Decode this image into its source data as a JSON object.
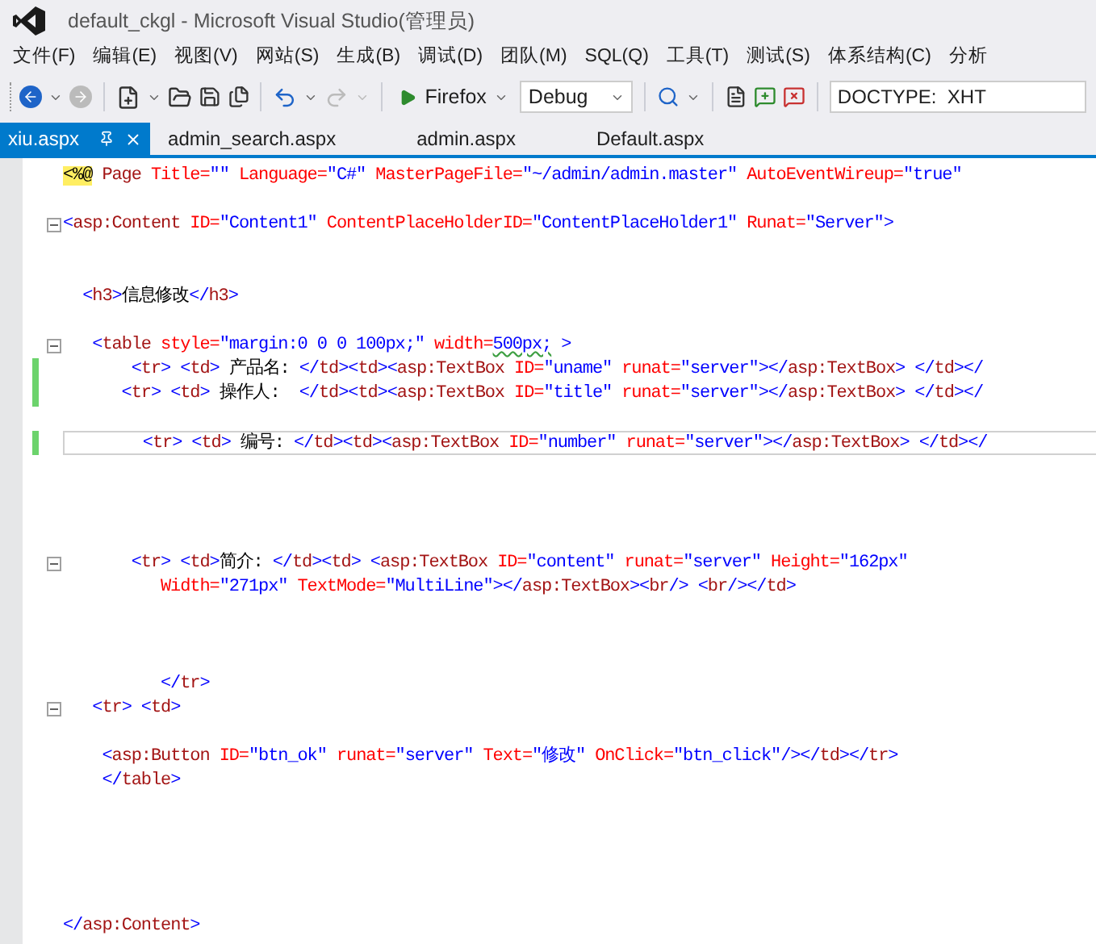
{
  "window": {
    "title": "default_ckgl - Microsoft Visual Studio(管理员)"
  },
  "menu": [
    "文件(F)",
    "编辑(E)",
    "视图(V)",
    "网站(S)",
    "生成(B)",
    "调试(D)",
    "团队(M)",
    "SQL(Q)",
    "工具(T)",
    "测试(S)",
    "体系结构(C)",
    "分析"
  ],
  "toolbar": {
    "browser": "Firefox",
    "configuration": "Debug",
    "doctype": "DOCTYPE:  XHT"
  },
  "tabs": [
    {
      "label": "xiu.aspx",
      "selected": true
    },
    {
      "label": "admin_search.aspx",
      "selected": false
    },
    {
      "label": "admin.aspx",
      "selected": false
    },
    {
      "label": "Default.aspx",
      "selected": false
    }
  ],
  "editor": {
    "lines": [
      {
        "kind": "code",
        "fold": false,
        "changed": false,
        "current": false,
        "tokens": [
          {
            "kind": "directive",
            "text": "<%@"
          },
          {
            "kind": "tag",
            "text": " Page "
          },
          {
            "kind": "attr",
            "text": "Title="
          },
          {
            "kind": "value",
            "text": "\"\""
          },
          {
            "kind": "attr",
            "text": " Language="
          },
          {
            "kind": "value",
            "text": "\"C#\""
          },
          {
            "kind": "attr",
            "text": " MasterPageFile="
          },
          {
            "kind": "value",
            "text": "\"~/admin/admin.master\""
          },
          {
            "kind": "attr",
            "text": " AutoEventWireup="
          },
          {
            "kind": "value",
            "text": "\"true\""
          }
        ]
      },
      {
        "kind": "blank"
      },
      {
        "kind": "code",
        "fold": true,
        "changed": false,
        "current": false,
        "tokens": [
          {
            "kind": "punct",
            "text": "<"
          },
          {
            "kind": "tag",
            "text": "asp:Content"
          },
          {
            "kind": "attr",
            "text": " ID="
          },
          {
            "kind": "value",
            "text": "\"Content1\""
          },
          {
            "kind": "attr",
            "text": " ContentPlaceHolderID="
          },
          {
            "kind": "value",
            "text": "\"ContentPlaceHolder1\""
          },
          {
            "kind": "attr",
            "text": " Runat="
          },
          {
            "kind": "value",
            "text": "\"Server\""
          },
          {
            "kind": "punct",
            "text": ">"
          }
        ]
      },
      {
        "kind": "blank"
      },
      {
        "kind": "blank"
      },
      {
        "kind": "code",
        "fold": false,
        "changed": false,
        "current": false,
        "tokens": [
          {
            "kind": "punct",
            "text": "  <"
          },
          {
            "kind": "tag",
            "text": "h3"
          },
          {
            "kind": "punct",
            "text": ">"
          },
          {
            "kind": "text",
            "text": "信息修改"
          },
          {
            "kind": "punct",
            "text": "</"
          },
          {
            "kind": "tag",
            "text": "h3"
          },
          {
            "kind": "punct",
            "text": ">"
          }
        ]
      },
      {
        "kind": "blank"
      },
      {
        "kind": "code",
        "fold": true,
        "changed": false,
        "current": false,
        "tokens": [
          {
            "kind": "punct",
            "text": "   <"
          },
          {
            "kind": "tag",
            "text": "table"
          },
          {
            "kind": "attr",
            "text": " style="
          },
          {
            "kind": "value",
            "text": "\"margin:0 0 0 100px;\""
          },
          {
            "kind": "attr",
            "text": " width="
          },
          {
            "kind": "squiggle",
            "text": "500px;"
          },
          {
            "kind": "punct",
            "text": " >"
          }
        ]
      },
      {
        "kind": "code",
        "fold": false,
        "changed": true,
        "current": false,
        "tokens": [
          {
            "kind": "punct",
            "text": "       <"
          },
          {
            "kind": "tag",
            "text": "tr"
          },
          {
            "kind": "punct",
            "text": "> <"
          },
          {
            "kind": "tag",
            "text": "td"
          },
          {
            "kind": "punct",
            "text": "> "
          },
          {
            "kind": "text",
            "text": "产品名: "
          },
          {
            "kind": "punct",
            "text": "</"
          },
          {
            "kind": "tag",
            "text": "td"
          },
          {
            "kind": "punct",
            "text": "><"
          },
          {
            "kind": "tag",
            "text": "td"
          },
          {
            "kind": "punct",
            "text": "><"
          },
          {
            "kind": "tag",
            "text": "asp:TextBox"
          },
          {
            "kind": "attr",
            "text": " ID="
          },
          {
            "kind": "value",
            "text": "\"uname\""
          },
          {
            "kind": "attr",
            "text": " runat="
          },
          {
            "kind": "value",
            "text": "\"server\""
          },
          {
            "kind": "punct",
            "text": "></"
          },
          {
            "kind": "tag",
            "text": "asp:TextBox"
          },
          {
            "kind": "punct",
            "text": "> </"
          },
          {
            "kind": "tag",
            "text": "td"
          },
          {
            "kind": "punct",
            "text": "></"
          }
        ]
      },
      {
        "kind": "code",
        "fold": false,
        "changed": true,
        "current": false,
        "tokens": [
          {
            "kind": "punct",
            "text": "      <"
          },
          {
            "kind": "tag",
            "text": "tr"
          },
          {
            "kind": "punct",
            "text": "> <"
          },
          {
            "kind": "tag",
            "text": "td"
          },
          {
            "kind": "punct",
            "text": "> "
          },
          {
            "kind": "text",
            "text": "操作人:  "
          },
          {
            "kind": "punct",
            "text": "</"
          },
          {
            "kind": "tag",
            "text": "td"
          },
          {
            "kind": "punct",
            "text": "><"
          },
          {
            "kind": "tag",
            "text": "td"
          },
          {
            "kind": "punct",
            "text": "><"
          },
          {
            "kind": "tag",
            "text": "asp:TextBox"
          },
          {
            "kind": "attr",
            "text": " ID="
          },
          {
            "kind": "value",
            "text": "\"title\""
          },
          {
            "kind": "attr",
            "text": " runat="
          },
          {
            "kind": "value",
            "text": "\"server\""
          },
          {
            "kind": "punct",
            "text": "></"
          },
          {
            "kind": "tag",
            "text": "asp:TextBox"
          },
          {
            "kind": "punct",
            "text": "> </"
          },
          {
            "kind": "tag",
            "text": "td"
          },
          {
            "kind": "punct",
            "text": "></"
          }
        ]
      },
      {
        "kind": "blank"
      },
      {
        "kind": "code",
        "fold": false,
        "changed": true,
        "current": true,
        "tokens": [
          {
            "kind": "punct",
            "text": "        <"
          },
          {
            "kind": "tag",
            "text": "tr"
          },
          {
            "kind": "punct",
            "text": "> <"
          },
          {
            "kind": "tag",
            "text": "td"
          },
          {
            "kind": "punct",
            "text": "> "
          },
          {
            "kind": "text",
            "text": "编号: "
          },
          {
            "kind": "punct",
            "text": "</"
          },
          {
            "kind": "tag",
            "text": "td"
          },
          {
            "kind": "punct",
            "text": "><"
          },
          {
            "kind": "tag",
            "text": "td"
          },
          {
            "kind": "punct",
            "text": "><"
          },
          {
            "kind": "tag",
            "text": "asp:TextBox"
          },
          {
            "kind": "attr",
            "text": " ID="
          },
          {
            "kind": "value",
            "text": "\"number\""
          },
          {
            "kind": "attr",
            "text": " runat="
          },
          {
            "kind": "value",
            "text": "\"server\""
          },
          {
            "kind": "punct",
            "text": "></"
          },
          {
            "kind": "tag",
            "text": "asp:TextBox"
          },
          {
            "kind": "punct",
            "text": "> </"
          },
          {
            "kind": "tag",
            "text": "td"
          },
          {
            "kind": "punct",
            "text": "></"
          }
        ]
      },
      {
        "kind": "blank"
      },
      {
        "kind": "blank"
      },
      {
        "kind": "blank"
      },
      {
        "kind": "blank"
      },
      {
        "kind": "code",
        "fold": true,
        "changed": false,
        "current": false,
        "tokens": [
          {
            "kind": "punct",
            "text": "       <"
          },
          {
            "kind": "tag",
            "text": "tr"
          },
          {
            "kind": "punct",
            "text": "> <"
          },
          {
            "kind": "tag",
            "text": "td"
          },
          {
            "kind": "punct",
            "text": ">"
          },
          {
            "kind": "text",
            "text": "简介: "
          },
          {
            "kind": "punct",
            "text": "</"
          },
          {
            "kind": "tag",
            "text": "td"
          },
          {
            "kind": "punct",
            "text": "><"
          },
          {
            "kind": "tag",
            "text": "td"
          },
          {
            "kind": "punct",
            "text": "> <"
          },
          {
            "kind": "tag",
            "text": "asp:TextBox"
          },
          {
            "kind": "attr",
            "text": " ID="
          },
          {
            "kind": "value",
            "text": "\"content\""
          },
          {
            "kind": "attr",
            "text": " runat="
          },
          {
            "kind": "value",
            "text": "\"server\""
          },
          {
            "kind": "attr",
            "text": " Height="
          },
          {
            "kind": "value",
            "text": "\"162px\""
          }
        ]
      },
      {
        "kind": "code",
        "fold": false,
        "changed": false,
        "current": false,
        "tokens": [
          {
            "kind": "attr",
            "text": "          Width="
          },
          {
            "kind": "value",
            "text": "\"271px\""
          },
          {
            "kind": "attr",
            "text": " TextMode="
          },
          {
            "kind": "value",
            "text": "\"MultiLine\""
          },
          {
            "kind": "punct",
            "text": "></"
          },
          {
            "kind": "tag",
            "text": "asp:TextBox"
          },
          {
            "kind": "punct",
            "text": "><"
          },
          {
            "kind": "tag",
            "text": "br"
          },
          {
            "kind": "punct",
            "text": "/> <"
          },
          {
            "kind": "tag",
            "text": "br"
          },
          {
            "kind": "punct",
            "text": "/></"
          },
          {
            "kind": "tag",
            "text": "td"
          },
          {
            "kind": "punct",
            "text": ">"
          }
        ]
      },
      {
        "kind": "blank"
      },
      {
        "kind": "blank"
      },
      {
        "kind": "blank"
      },
      {
        "kind": "code",
        "fold": false,
        "changed": false,
        "current": false,
        "tokens": [
          {
            "kind": "punct",
            "text": "          </"
          },
          {
            "kind": "tag",
            "text": "tr"
          },
          {
            "kind": "punct",
            "text": ">"
          }
        ]
      },
      {
        "kind": "code",
        "fold": true,
        "changed": false,
        "current": false,
        "tokens": [
          {
            "kind": "punct",
            "text": "   <"
          },
          {
            "kind": "tag",
            "text": "tr"
          },
          {
            "kind": "punct",
            "text": "> <"
          },
          {
            "kind": "tag",
            "text": "td"
          },
          {
            "kind": "punct",
            "text": ">"
          }
        ]
      },
      {
        "kind": "blank"
      },
      {
        "kind": "code",
        "fold": false,
        "changed": false,
        "current": false,
        "tokens": [
          {
            "kind": "punct",
            "text": "    <"
          },
          {
            "kind": "tag",
            "text": "asp:Button"
          },
          {
            "kind": "attr",
            "text": " ID="
          },
          {
            "kind": "value",
            "text": "\"btn_ok\""
          },
          {
            "kind": "attr",
            "text": " runat="
          },
          {
            "kind": "value",
            "text": "\"server\""
          },
          {
            "kind": "attr",
            "text": " Text="
          },
          {
            "kind": "value",
            "text": "\"修改\""
          },
          {
            "kind": "attr",
            "text": " OnClick="
          },
          {
            "kind": "value",
            "text": "\"btn_click\""
          },
          {
            "kind": "punct",
            "text": "/></"
          },
          {
            "kind": "tag",
            "text": "td"
          },
          {
            "kind": "punct",
            "text": "></"
          },
          {
            "kind": "tag",
            "text": "tr"
          },
          {
            "kind": "punct",
            "text": ">"
          }
        ]
      },
      {
        "kind": "code",
        "fold": false,
        "changed": false,
        "current": false,
        "tokens": [
          {
            "kind": "punct",
            "text": "    </"
          },
          {
            "kind": "tag",
            "text": "table"
          },
          {
            "kind": "punct",
            "text": ">"
          }
        ]
      },
      {
        "kind": "blank"
      },
      {
        "kind": "blank"
      },
      {
        "kind": "blank"
      },
      {
        "kind": "blank"
      },
      {
        "kind": "blank"
      },
      {
        "kind": "code",
        "fold": false,
        "changed": false,
        "current": false,
        "tokens": [
          {
            "kind": "punct",
            "text": "</"
          },
          {
            "kind": "tag",
            "text": "asp:Content"
          },
          {
            "kind": "punct",
            "text": ">"
          }
        ]
      }
    ]
  }
}
